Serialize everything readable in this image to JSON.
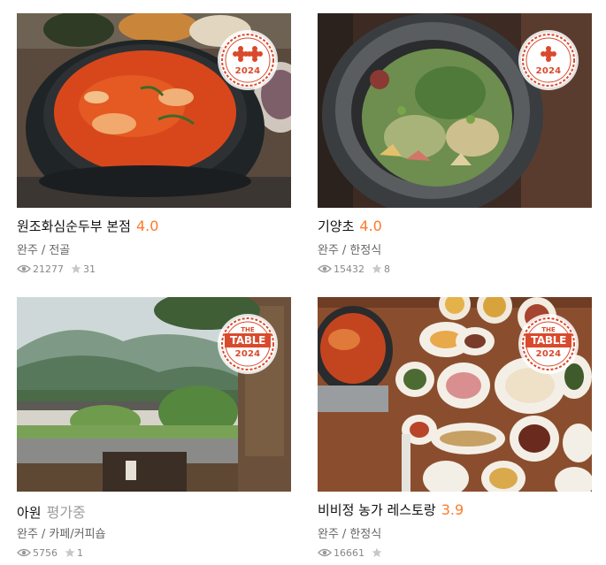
{
  "restaurants": [
    {
      "name": "원조화심순두부 본점",
      "score": "4.0",
      "region": "완주",
      "category": "전골",
      "views": "21277",
      "reviews": "31",
      "badge": {
        "type": "ribbon",
        "ribbons": 2,
        "year": "2024"
      }
    },
    {
      "name": "기양초",
      "score": "4.0",
      "region": "완주",
      "category": "한정식",
      "views": "15432",
      "reviews": "8",
      "badge": {
        "type": "ribbon",
        "ribbons": 1,
        "year": "2024"
      }
    },
    {
      "name": "아원",
      "score": "평가중",
      "region": "완주",
      "category": "카페/커피숍",
      "views": "5756",
      "reviews": "1",
      "badge": {
        "type": "table",
        "top": "THE",
        "main": "TABLE",
        "year": "2024"
      }
    },
    {
      "name": "비비정 농가 레스토랑",
      "score": "3.9",
      "region": "완주",
      "category": "한정식",
      "views": "16661",
      "reviews": "",
      "badge": {
        "type": "table",
        "top": "THE",
        "main": "TABLE",
        "year": "2024"
      }
    }
  ],
  "separator": "/",
  "icons": {
    "views": "eye-icon",
    "reviews": "star-icon"
  },
  "colors": {
    "score": "#ff792a",
    "pending": "#9b9b9b",
    "badge": "#d94a2c"
  }
}
